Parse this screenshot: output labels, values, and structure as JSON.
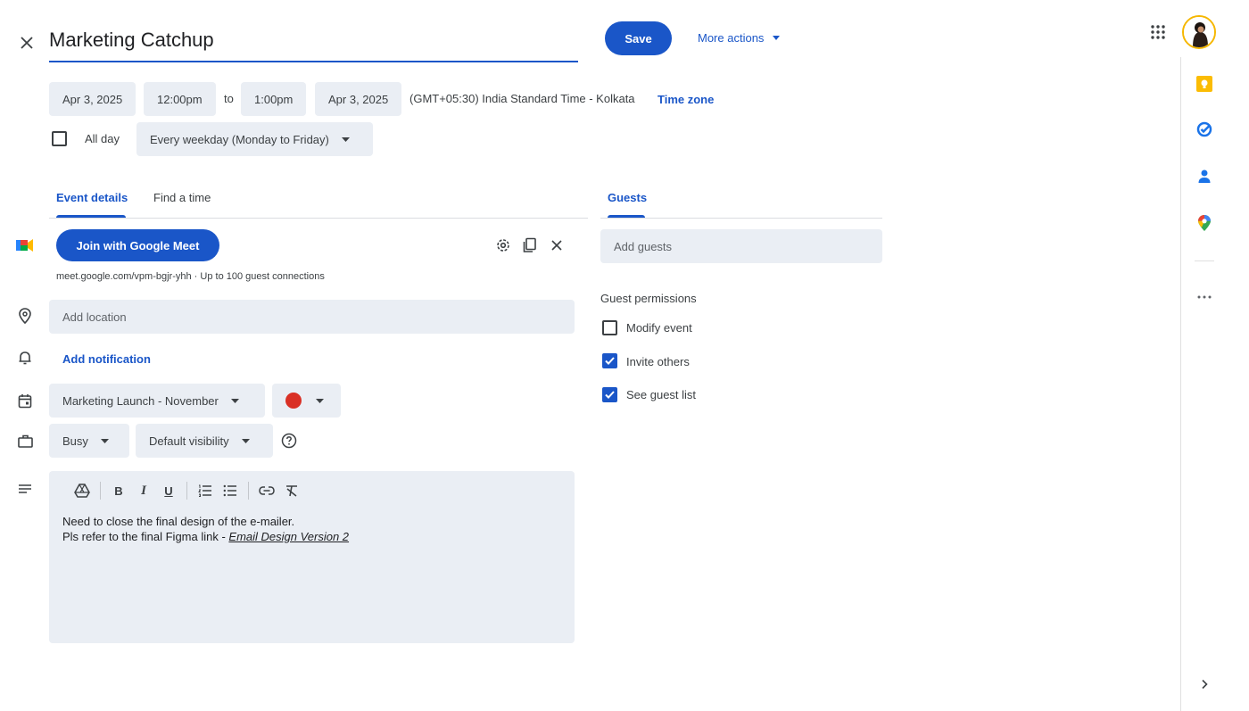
{
  "header": {
    "title_value": "Marketing Catchup",
    "save_label": "Save",
    "more_actions_label": "More actions"
  },
  "datetime": {
    "start_date": "Apr 3, 2025",
    "start_time": "12:00pm",
    "to_label": "to",
    "end_time": "1:00pm",
    "end_date": "Apr 3, 2025",
    "timezone_text": "(GMT+05:30) India Standard Time - Kolkata",
    "timezone_link": "Time zone",
    "all_day_label": "All day",
    "recurrence": "Every weekday (Monday to Friday)"
  },
  "tabs": {
    "event_details": "Event details",
    "find_a_time": "Find a time",
    "guests": "Guests"
  },
  "meet": {
    "button_label": "Join with Google Meet",
    "info": "meet.google.com/vpm-bgjr-yhh · Up to 100 guest connections"
  },
  "location": {
    "placeholder": "Add location"
  },
  "notification": {
    "label": "Add notification"
  },
  "calendar": {
    "name": "Marketing Launch - November",
    "color": "#d93025"
  },
  "availability": {
    "status": "Busy",
    "visibility": "Default visibility"
  },
  "description": {
    "line1": "Need to close the final design of the e-mailer.",
    "line2_prefix": "Pls refer to the final Figma link - ",
    "line2_link": "Email Design Version 2"
  },
  "guests": {
    "placeholder": "Add guests",
    "permissions_title": "Guest permissions",
    "permissions": [
      {
        "label": "Modify event",
        "checked": false
      },
      {
        "label": "Invite others",
        "checked": true
      },
      {
        "label": "See guest list",
        "checked": true
      }
    ]
  },
  "colors": {
    "accent": "#1a56c8",
    "field_bg": "#eaeef4"
  },
  "icons": {
    "rail": [
      "keep-icon",
      "tasks-icon",
      "contacts-icon",
      "maps-icon",
      "more-icon",
      "chevron-right-icon"
    ]
  }
}
